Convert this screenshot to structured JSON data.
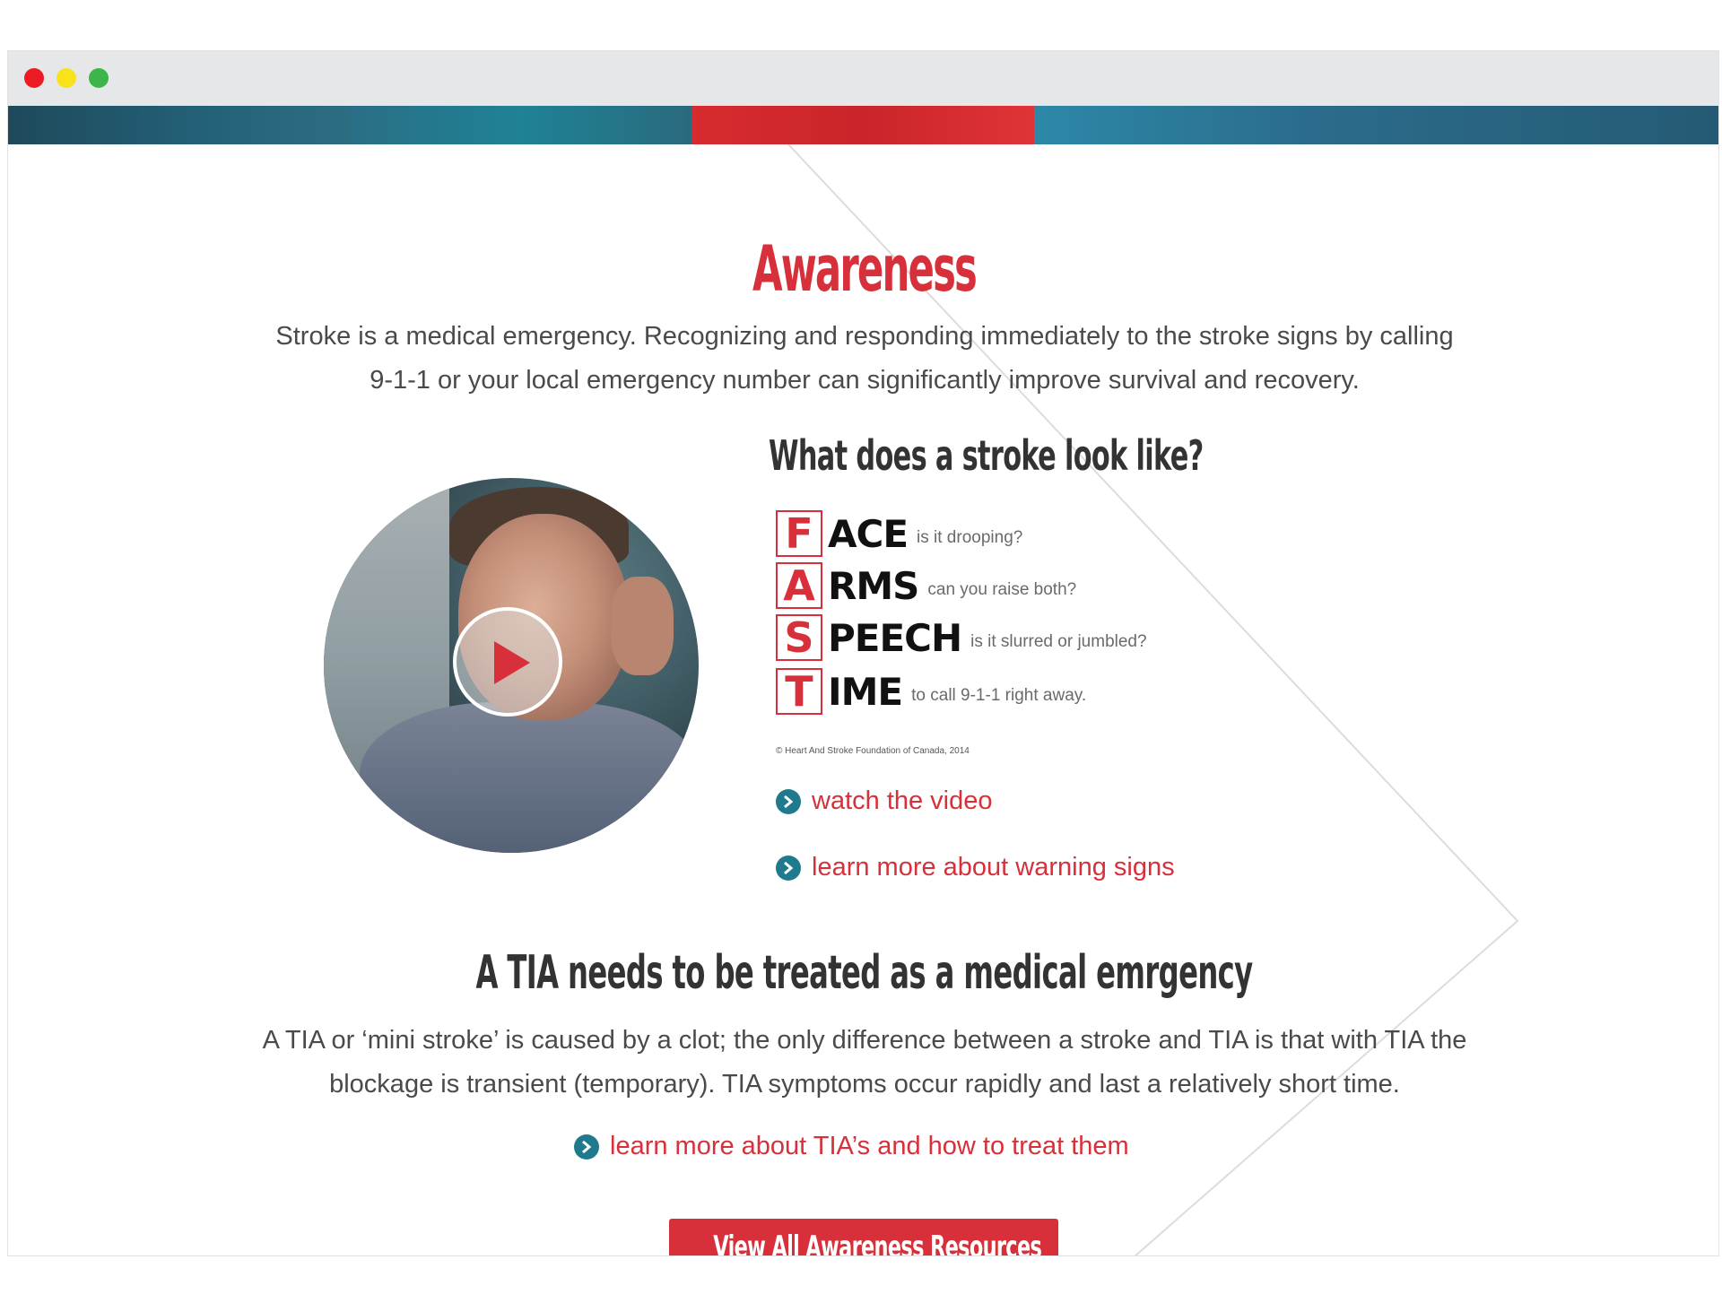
{
  "colors": {
    "accent": "#d8303a",
    "link_icon": "#1e7a8c",
    "titlebar": "#e6e7e8"
  },
  "section": {
    "title": "Awareness",
    "intro": "Stroke is a medical emergency. Recognizing and responding immediately to the stroke signs by calling 9-1-1 or your local emergency number can significantly improve survival and recovery."
  },
  "video": {
    "play_icon": "play-icon"
  },
  "fast": {
    "question": "What does a stroke look like?",
    "items": [
      {
        "letter": "F",
        "word": "ACE",
        "desc": "is it drooping?"
      },
      {
        "letter": "A",
        "word": "RMS",
        "desc": "can you raise both?"
      },
      {
        "letter": "S",
        "word": "PEECH",
        "desc": "is it slurred or jumbled?"
      },
      {
        "letter": "T",
        "word": "IME",
        "desc": "to call 9-1-1 right away."
      }
    ],
    "copyright": "© Heart And Stroke Foundation of Canada, 2014"
  },
  "links": {
    "watch_video": "watch the video",
    "warning_signs": "learn more about warning signs",
    "tia": "learn more about TIA’s and how to treat them"
  },
  "tia": {
    "heading": "A TIA needs to be treated as a medical emrgency",
    "body": "A TIA  or ‘mini stroke’ is caused by a clot; the only difference between a stroke and TIA is that with TIA the blockage is transient (temporary). TIA symptoms occur rapidly and last a relatively short time."
  },
  "cta": {
    "label": "View All Awareness Resources"
  }
}
